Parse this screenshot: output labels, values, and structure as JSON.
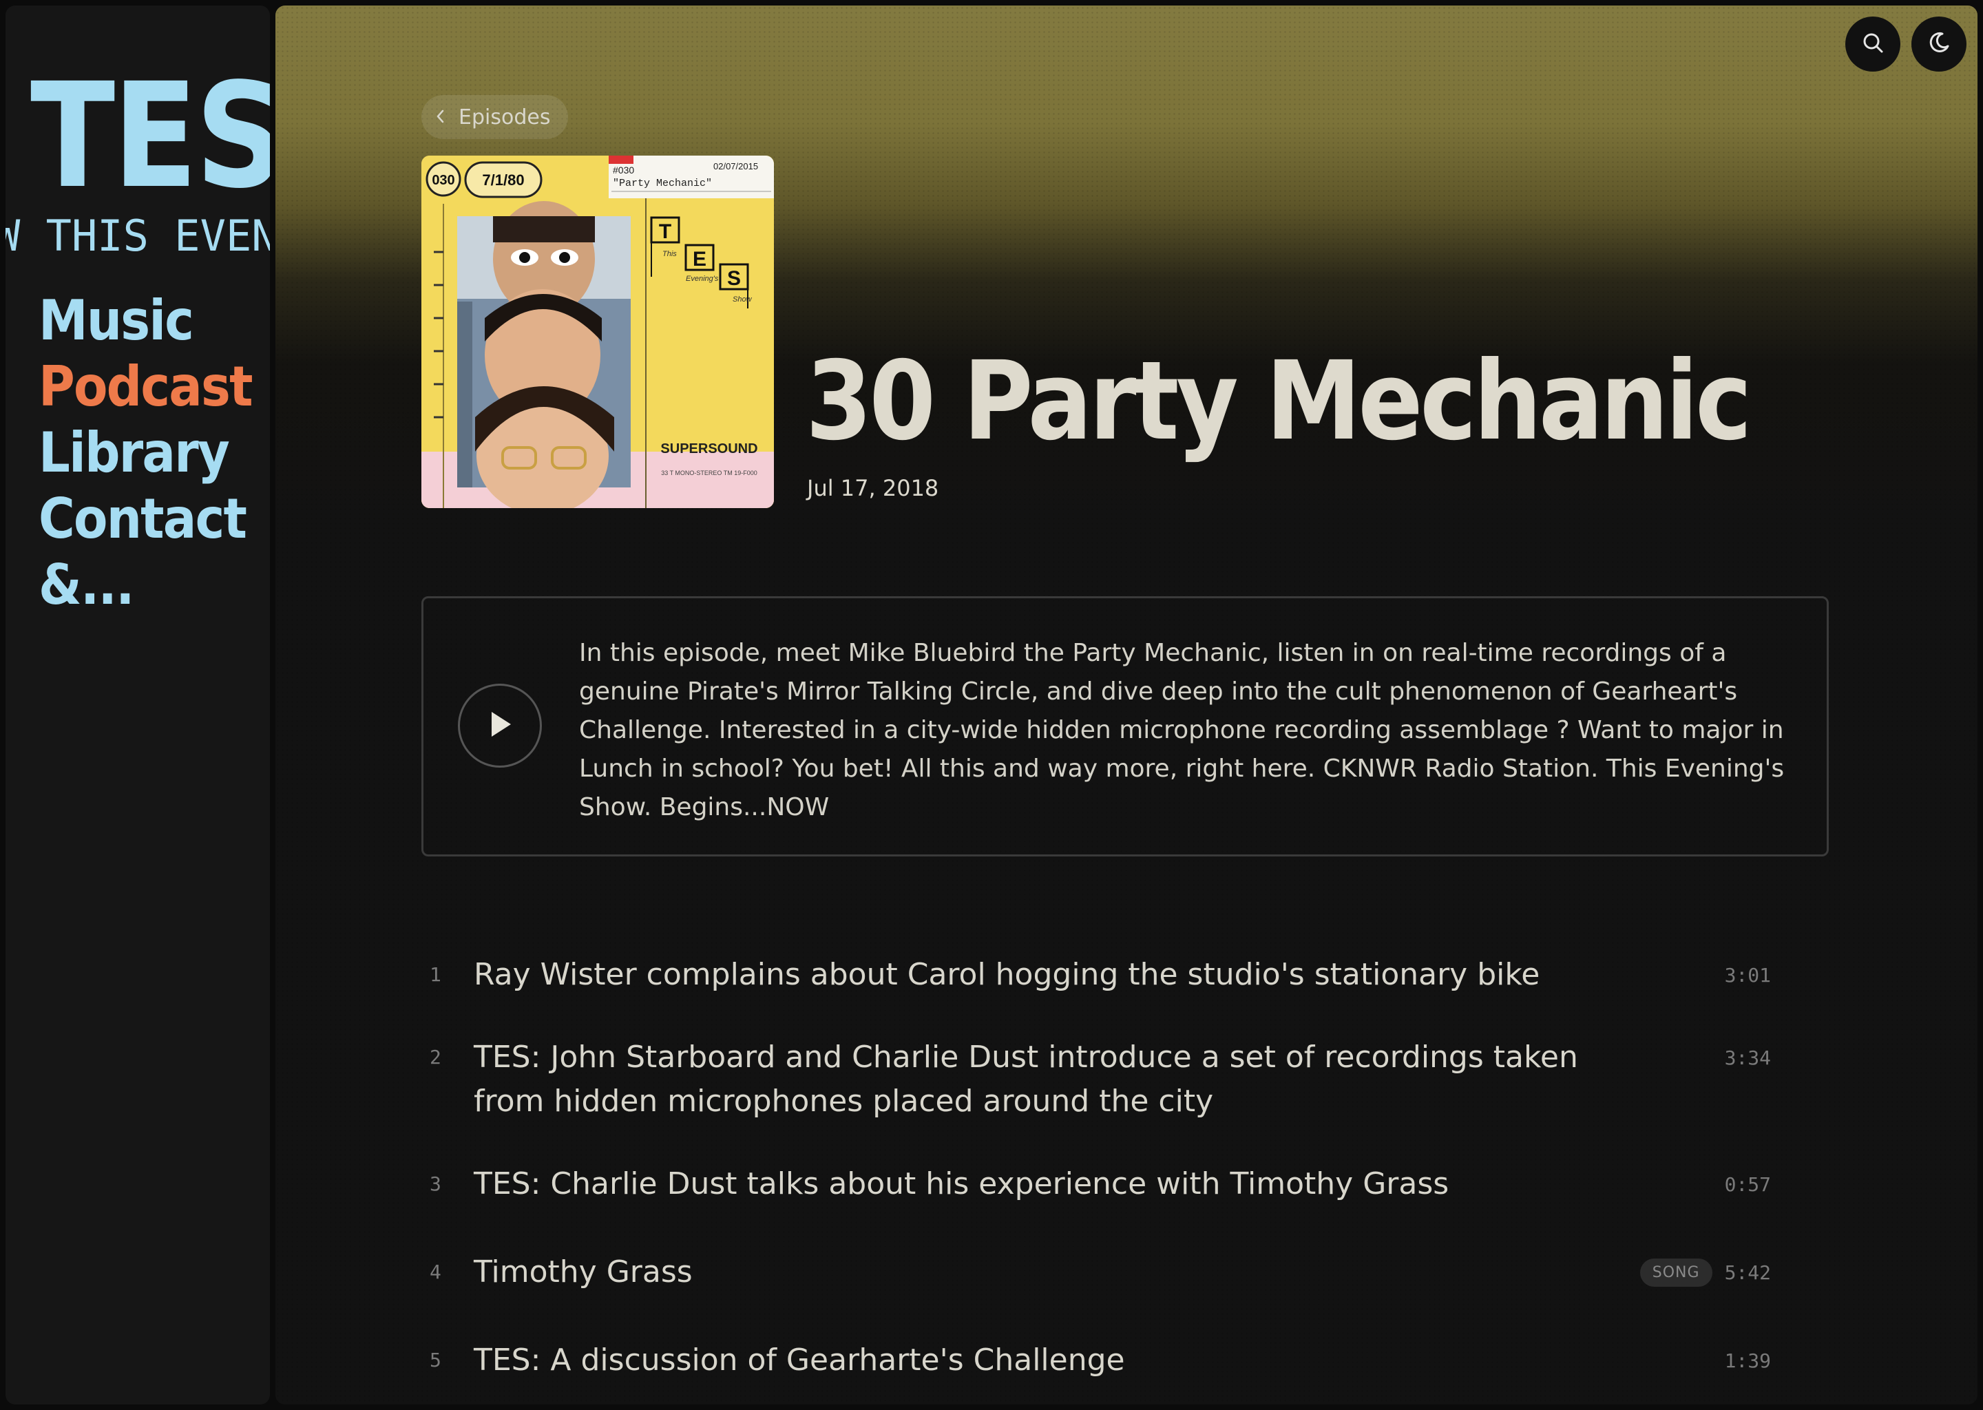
{
  "sidebar": {
    "logo_big": "TES",
    "logo_small": "W THIS EVEN",
    "nav": [
      {
        "label": "Music",
        "active": false
      },
      {
        "label": "Podcast",
        "active": true
      },
      {
        "label": "Library",
        "active": false
      },
      {
        "label": "Contact",
        "active": false
      },
      {
        "label": "&...",
        "active": false
      }
    ]
  },
  "header": {
    "search_icon": "search-icon",
    "theme_icon": "moon-icon"
  },
  "back": {
    "label": "Episodes",
    "icon": "chevron-left-icon"
  },
  "cover": {
    "badge_number": "030",
    "badge_date": "7/1/80",
    "label_number": "#030",
    "label_title": "\"Party Mechanic\"",
    "label_date": "02/07/2015",
    "brand": "SUPERSOUND",
    "logo_letters": [
      "T",
      "E",
      "S"
    ],
    "logo_words": [
      "This",
      "Evening's",
      "Show"
    ],
    "small_print": "33 T MONO-STEREO TM 19-F000"
  },
  "episode": {
    "title": "30 Party Mechanic",
    "date": "Jul 17, 2018",
    "description": "In this episode, meet Mike Bluebird the Party Mechanic, listen in on real-time recordings of a genuine Pirate's Mirror Talking Circle, and dive deep into the cult phenomenon of Gearheart's Challenge. Interested in a city-wide hidden microphone recording assemblage ? Want to major in Lunch in school? You bet! All this and way more, right here. CKNWR Radio Station. This Evening's Show. Begins...NOW"
  },
  "tracks": [
    {
      "num": "1",
      "title": "Ray Wister complains about Carol hogging the studio's stationary bike",
      "badge": "",
      "duration": "3:01"
    },
    {
      "num": "2",
      "title": "TES: John Starboard and Charlie Dust introduce a set of recordings taken from hidden microphones placed around the city",
      "badge": "",
      "duration": "3:34"
    },
    {
      "num": "3",
      "title": "TES: Charlie Dust talks about his experience with Timothy Grass",
      "badge": "",
      "duration": "0:57"
    },
    {
      "num": "4",
      "title": "Timothy Grass",
      "badge": "SONG",
      "duration": "5:42"
    },
    {
      "num": "5",
      "title": "TES: A discussion of Gearharte's Challenge",
      "badge": "",
      "duration": "1:39"
    }
  ],
  "colors": {
    "accent_blue": "#a6dcf2",
    "accent_orange": "#ee7a4a",
    "header_gradient": "#837a40"
  }
}
